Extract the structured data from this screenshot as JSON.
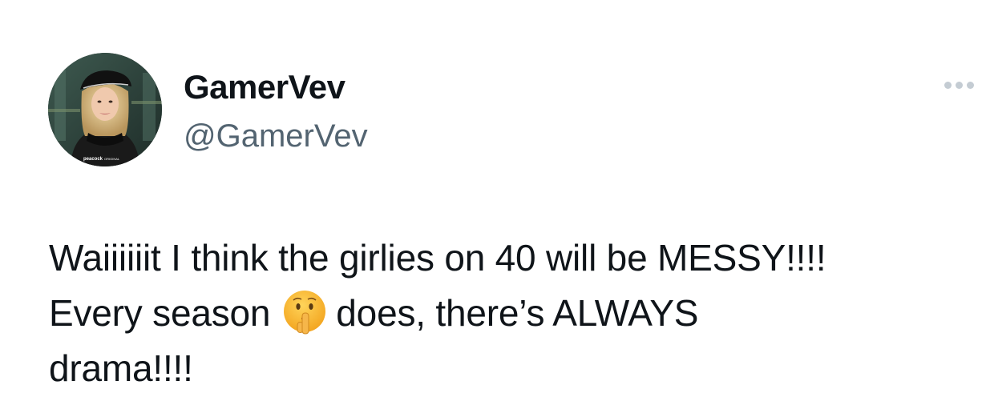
{
  "tweet": {
    "author": {
      "display_name": "GamerVev",
      "handle": "@GamerVev",
      "avatar_badge": "peacock ORIGINAL"
    },
    "more_icon": "more-horizontal-icon",
    "text": {
      "line1": "Waiiiiiit I think the girlies on 40 will be MESSY!!!!",
      "line2_before": "Every season",
      "emoji": "shushing-face-emoji",
      "line2_after": "does, there’s ALWAYS",
      "line3": "drama!!!!"
    }
  },
  "colors": {
    "text_primary": "#0f1419",
    "text_secondary": "#536471",
    "more_dots": "#c4ccd3",
    "background": "#ffffff"
  }
}
